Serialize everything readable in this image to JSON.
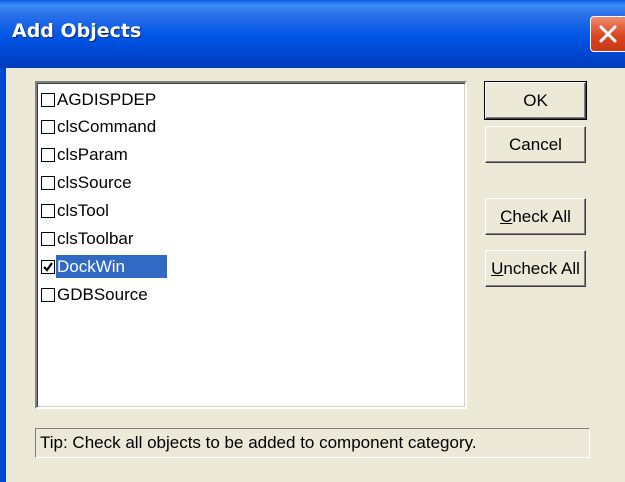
{
  "window": {
    "title": "Add Objects"
  },
  "list": {
    "items": [
      {
        "label": "AGDISPDEP",
        "checked": false,
        "selected": false
      },
      {
        "label": "clsCommand",
        "checked": false,
        "selected": false
      },
      {
        "label": "clsParam",
        "checked": false,
        "selected": false
      },
      {
        "label": "clsSource",
        "checked": false,
        "selected": false
      },
      {
        "label": "clsTool",
        "checked": false,
        "selected": false
      },
      {
        "label": "clsToolbar",
        "checked": false,
        "selected": false
      },
      {
        "label": "DockWin",
        "checked": true,
        "selected": true
      },
      {
        "label": "GDBSource",
        "checked": false,
        "selected": false
      }
    ]
  },
  "buttons": {
    "ok": "OK",
    "cancel": "Cancel",
    "check_all_first": "C",
    "check_all_rest": "heck All",
    "uncheck_all_first": "U",
    "uncheck_all_rest": "ncheck All"
  },
  "tip": {
    "text": "Tip:  Check all objects to be added to component category."
  },
  "colors": {
    "title_bar": "#0055e5",
    "selection": "#316ac5",
    "close_button": "#d94520",
    "dialog_bg": "#ece9d8"
  }
}
